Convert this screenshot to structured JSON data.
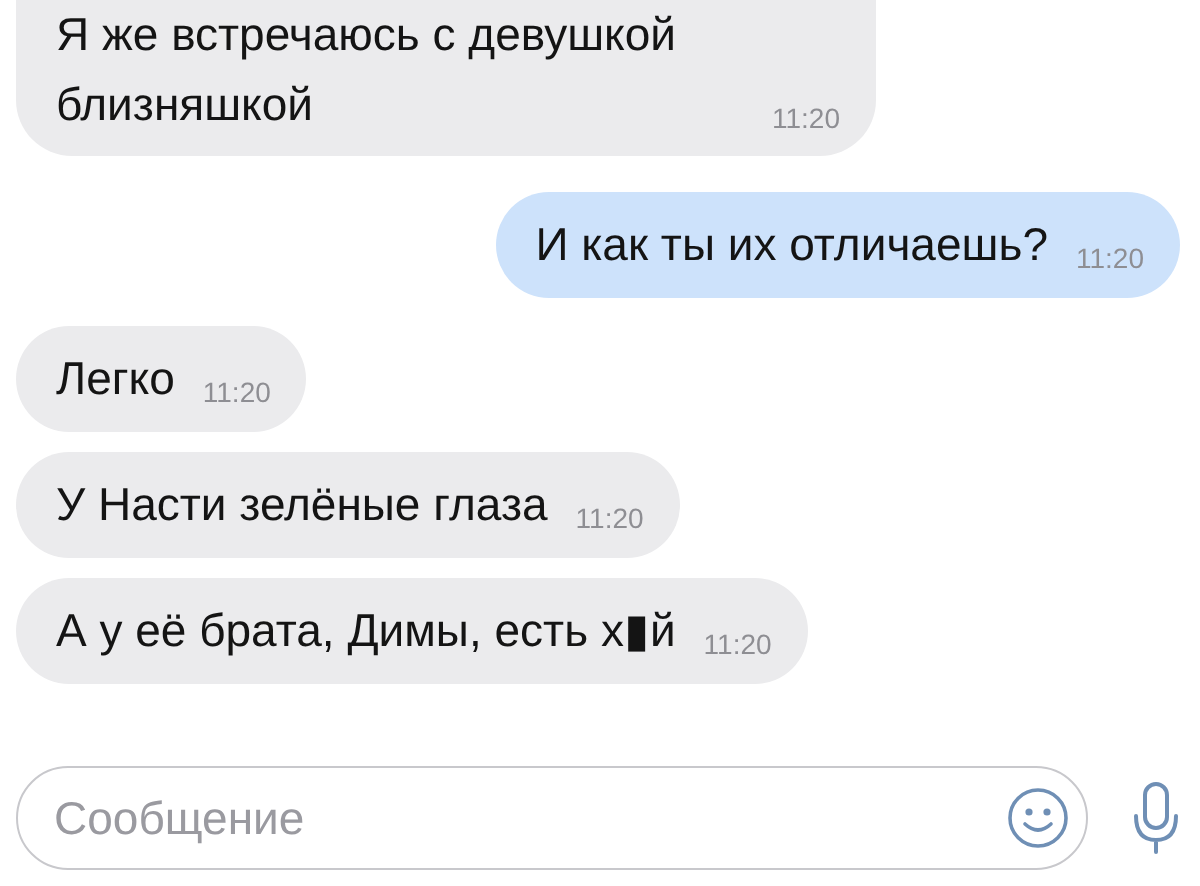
{
  "messages": [
    {
      "kind": "incoming",
      "text": "Я же встречаюсь с девушкой близняшкой",
      "time": "11:20"
    },
    {
      "kind": "outgoing",
      "text": "И как ты их отличаешь?",
      "time": "11:20"
    },
    {
      "kind": "incoming",
      "text": "Легко",
      "time": "11:20"
    },
    {
      "kind": "incoming",
      "text": "У Насти зелёные глаза",
      "time": "11:20"
    },
    {
      "kind": "incoming",
      "text": "А у её брата, Димы, есть х▮й",
      "time": "11:20"
    }
  ],
  "composer": {
    "placeholder": "Сообщение"
  }
}
